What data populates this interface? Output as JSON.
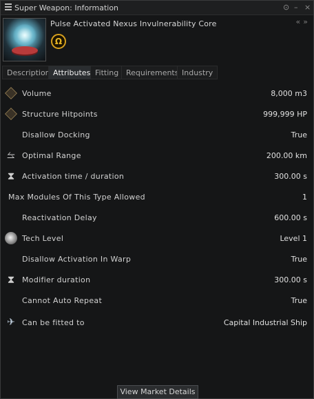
{
  "window": {
    "title": "Super Weapon: Information",
    "controls": [
      "⊙",
      "–",
      "×"
    ]
  },
  "item": {
    "name": "Pulse Activated Nexus Invulnerability Core",
    "badge_glyph": "Ω",
    "header_arrows": [
      "«",
      "»"
    ]
  },
  "tabs": [
    {
      "label": "Description",
      "active": false
    },
    {
      "label": "Attributes",
      "active": true
    },
    {
      "label": "Fitting",
      "active": false
    },
    {
      "label": "Requirements",
      "active": false
    },
    {
      "label": "Industry",
      "active": false
    }
  ],
  "attributes": [
    {
      "label": "Volume",
      "value": "8,000 m3",
      "icon": "volume-icon"
    },
    {
      "label": "Structure Hitpoints",
      "value": "999,999 HP",
      "icon": "hitpoints-icon"
    },
    {
      "label": "Disallow Docking",
      "value": "True",
      "icon": ""
    },
    {
      "label": "Optimal Range",
      "value": "200.00 km",
      "icon": "range-icon"
    },
    {
      "label": "Activation time / duration",
      "value": "300.00 s",
      "icon": "hourglass-icon"
    },
    {
      "label": "Max Modules Of This Type Allowed",
      "value": "1",
      "icon": ""
    },
    {
      "label": "Reactivation Delay",
      "value": "600.00 s",
      "icon": ""
    },
    {
      "label": "Tech Level",
      "value": "Level 1",
      "icon": "tech-level-icon"
    },
    {
      "label": "Disallow Activation In Warp",
      "value": "True",
      "icon": ""
    },
    {
      "label": "Modifier duration",
      "value": "300.00 s",
      "icon": "hourglass-icon"
    },
    {
      "label": "Cannot Auto Repeat",
      "value": "True",
      "icon": ""
    },
    {
      "label": "Can be fitted to",
      "value": "Capital Industrial Ship",
      "icon": "ship-icon"
    }
  ],
  "footer": {
    "market_button": "View Market Details"
  },
  "colors": {
    "omega_gold": "#d7a01e",
    "background": "#151617"
  }
}
